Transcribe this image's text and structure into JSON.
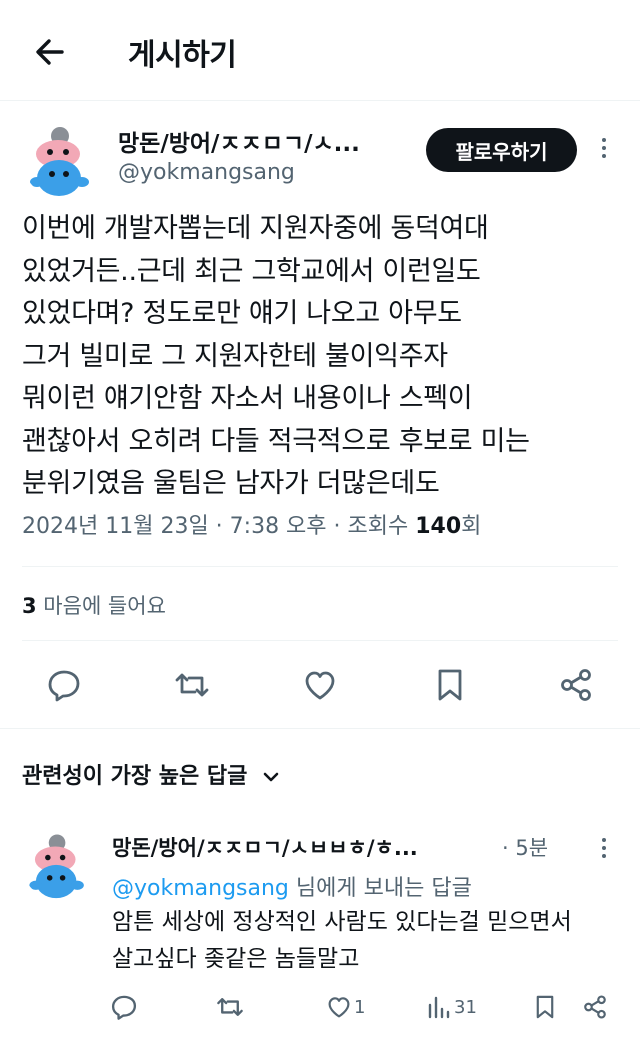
{
  "header": {
    "title": "게시하기"
  },
  "tweet": {
    "display_name": "망돈/방어/ㅈㅈㅁㄱ/ㅅ...",
    "handle": "@yokmangsang",
    "follow_label": "팔로우하기",
    "lines": [
      "이번에 개발자뽑는데 지원자중에 동덕여대",
      "있었거든..근데 최근 그학교에서 이런일도",
      "있었다며? 정도로만 얘기 나오고 아무도",
      "그거 빌미로 그 지원자한테 불이익주자",
      "뭐이런 얘기안함 자소서 내용이나 스펙이",
      "괜찮아서 오히려 다들 적극적으로 후보로 미는",
      "분위기였음 울팀은 남자가 더많은데도"
    ],
    "date": "2024년 11월 23일 · 7:38 오후 · 조회수 ",
    "views": "140",
    "views_suffix": "회",
    "likes_count": "3",
    "likes_label": " 마음에 들어요"
  },
  "replies_section": {
    "title": "관련성이 가장 높은 답글"
  },
  "reply": {
    "display_name": "망돈/방어/ㅈㅈㅁㄱ/ㅅㅂㅂㅎ/ㅎ...",
    "time": "· 5분",
    "to_handle": "@yokmangsang",
    "to_suffix": " 님에게 보내는 답글",
    "lines": [
      "암튼 세상에 정상적인 사람도 있다는걸 믿으면서",
      "살고싶다 좆같은 놈들말고"
    ],
    "likes": "1",
    "views": "31"
  },
  "colors": {
    "link": "#1d9bf0",
    "muted": "#536471",
    "text": "#0f1419",
    "avatar_bg": "#f2a8b6",
    "avatar_body": "#3b9fe8"
  }
}
